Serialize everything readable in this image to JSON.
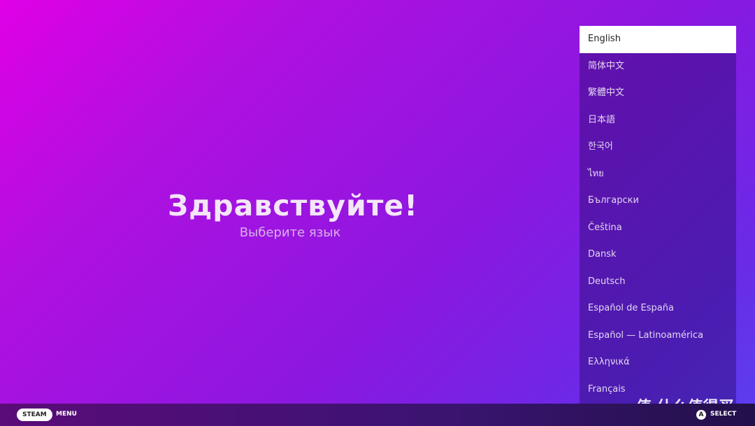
{
  "hero": {
    "title": "Здравствуйте!",
    "subtitle": "Выберите язык"
  },
  "languages": [
    "English",
    "简体中文",
    "繁體中文",
    "日本語",
    "한국어",
    "ไทย",
    "Български",
    "Čeština",
    "Dansk",
    "Deutsch",
    "Español de España",
    "Español — Latinoamérica",
    "Ελληνικά",
    "Français"
  ],
  "selected": "English",
  "footer": {
    "steam": "STEAM",
    "menu": "MENU",
    "a": "A",
    "select": "SELECT"
  },
  "watermark": "值 什么值得买"
}
